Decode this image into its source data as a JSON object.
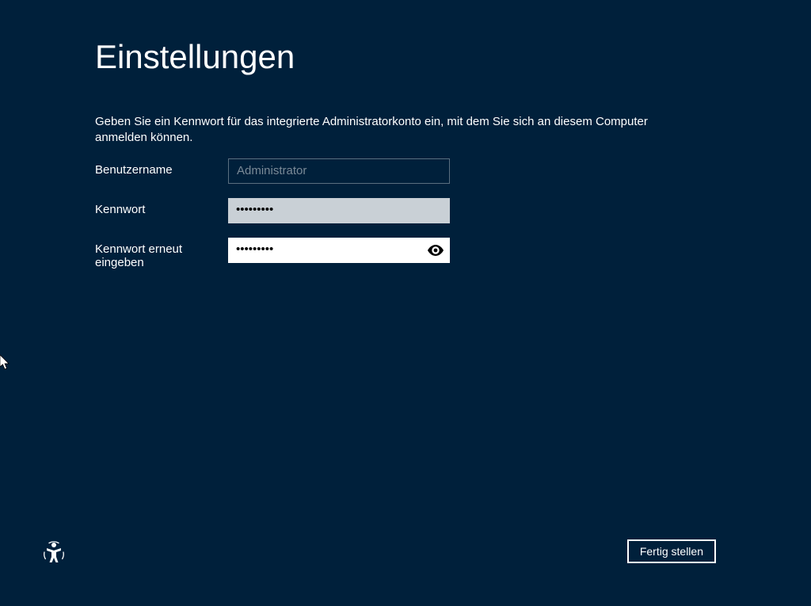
{
  "colors": {
    "background": "#00203b",
    "text": "#ffffff",
    "border_highlight": "#ffffff"
  },
  "heading": "Einstellungen",
  "instruction": "Geben Sie ein Kennwort für das integrierte Administratorkonto ein, mit dem Sie sich an diesem Computer anmelden können.",
  "form": {
    "username_label": "Benutzername",
    "username_value": "Administrator",
    "password_label": "Kennwort",
    "password_mask": "•••••••••",
    "confirm_label": "Kennwort erneut eingeben",
    "confirm_mask": "•••••••••"
  },
  "icons": {
    "reveal": "eye-icon",
    "ease_of_access": "ease-of-access-icon"
  },
  "footer": {
    "finish_label": "Fertig stellen"
  }
}
